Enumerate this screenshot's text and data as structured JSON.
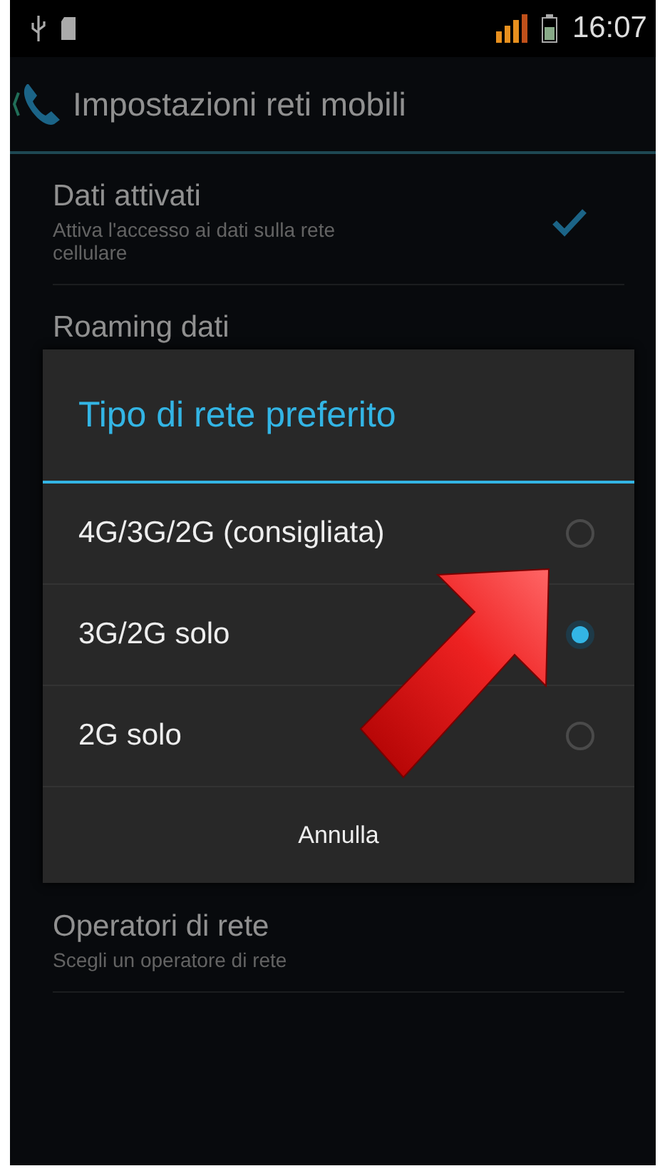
{
  "status_bar": {
    "time": "16:07"
  },
  "action_bar": {
    "title": "Impostazioni reti mobili"
  },
  "settings": [
    {
      "kind": "checkbox",
      "title": "Dati attivati",
      "summary": "Attiva l'accesso ai dati sulla rete cellulare",
      "checked": true
    },
    {
      "kind": "plain",
      "title": "Roaming dati"
    },
    {
      "kind": "gap"
    },
    {
      "kind": "plain",
      "title": "Operatori di rete",
      "summary": "Scegli un operatore di rete"
    }
  ],
  "dialog": {
    "title": "Tipo di rete preferito",
    "options": [
      {
        "label": "4G/3G/2G (consigliata)",
        "selected": false
      },
      {
        "label": "3G/2G solo",
        "selected": true
      },
      {
        "label": "2G solo",
        "selected": false
      }
    ],
    "button": "Annulla"
  }
}
